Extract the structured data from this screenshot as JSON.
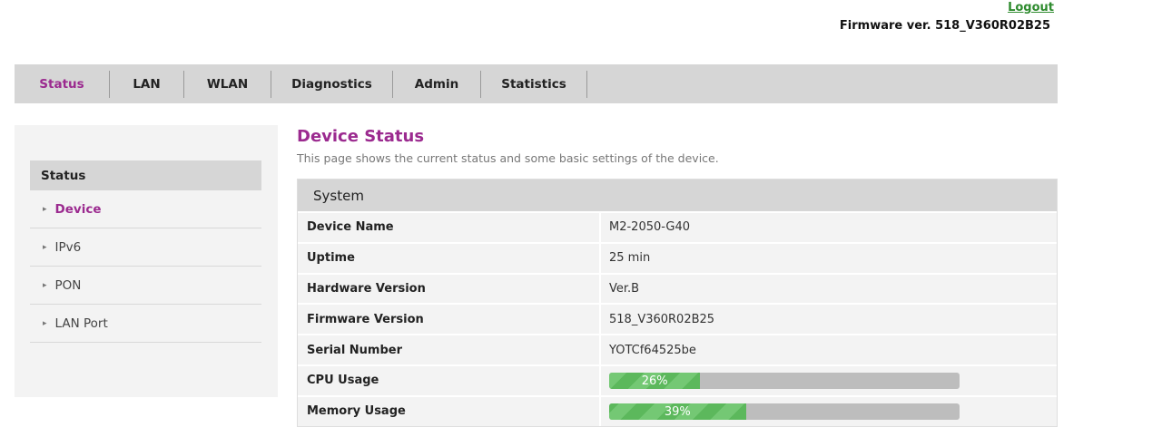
{
  "header": {
    "logout_label": "Logout",
    "firmware_label": "Firmware ver. 518_V360R02B25"
  },
  "nav": {
    "items": [
      {
        "label": "Status",
        "active": true
      },
      {
        "label": "LAN"
      },
      {
        "label": "WLAN"
      },
      {
        "label": "Diagnostics"
      },
      {
        "label": "Admin"
      },
      {
        "label": "Statistics"
      }
    ]
  },
  "sidebar": {
    "heading": "Status",
    "items": [
      {
        "label": "Device",
        "active": true
      },
      {
        "label": "IPv6"
      },
      {
        "label": "PON"
      },
      {
        "label": "LAN Port"
      }
    ]
  },
  "main": {
    "title": "Device Status",
    "description": "This page shows the current status and some basic settings of the device.",
    "panel_title": "System",
    "rows": [
      {
        "label": "Device Name",
        "value": "M2-2050-G40"
      },
      {
        "label": "Uptime",
        "value": "25 min"
      },
      {
        "label": "Hardware Version",
        "value": "Ver.B"
      },
      {
        "label": "Firmware Version",
        "value": "518_V360R02B25"
      },
      {
        "label": "Serial Number",
        "value": "YOTCf64525be"
      }
    ],
    "cpu": {
      "label": "CPU Usage",
      "percent_text": "26%",
      "percent": 26
    },
    "memory": {
      "label": "Memory Usage",
      "percent_text": "39%",
      "percent": 39
    }
  },
  "colors": {
    "accent": "#9b2a8f",
    "logout": "#2e8b2e",
    "bar_fill": "#5cb85c",
    "bar_track": "#bdbdbd"
  }
}
